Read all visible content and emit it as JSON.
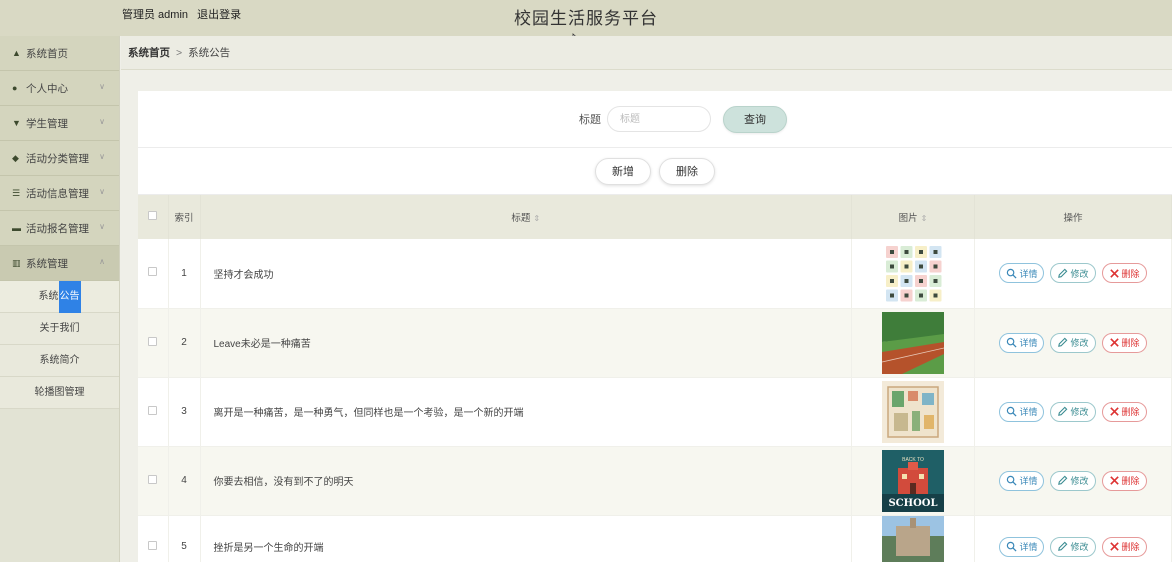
{
  "header": {
    "user_label": "管理员 admin",
    "logout_label": "退出登录",
    "title": "校园生活服务平台"
  },
  "breadcrumb": {
    "home": "系统首页",
    "separator": ">",
    "current": "系统公告"
  },
  "sidebar": {
    "items": [
      {
        "label": "系统首页",
        "icon": "home-icon"
      },
      {
        "label": "个人中心",
        "icon": "user-icon"
      },
      {
        "label": "学生管理",
        "icon": "student-icon"
      },
      {
        "label": "活动分类管理",
        "icon": "category-icon"
      },
      {
        "label": "活动信息管理",
        "icon": "info-icon"
      },
      {
        "label": "活动报名管理",
        "icon": "signup-icon"
      },
      {
        "label": "系统管理",
        "icon": "chart-icon"
      }
    ],
    "submenu": [
      {
        "label_a": "系统",
        "label_b": "公告"
      },
      {
        "label": "关于我们"
      },
      {
        "label": "系统简介"
      },
      {
        "label": "轮播图管理"
      }
    ]
  },
  "search": {
    "label": "标题",
    "placeholder": "标题",
    "query_label": "查询"
  },
  "actions": {
    "add_label": "新增",
    "delete_label": "删除"
  },
  "table": {
    "headers": {
      "index": "索引",
      "title": "标题",
      "image": "图片",
      "ops": "操作"
    },
    "sort_glyph": "⇕",
    "op_labels": {
      "detail": "详情",
      "edit": "修改",
      "delete": "删除"
    },
    "rows": [
      {
        "index": "1",
        "title": "坚持才会成功",
        "image": "icon-grid-picture"
      },
      {
        "index": "2",
        "title": "Leave未必是一种痛苦",
        "image": "running-track-picture"
      },
      {
        "index": "3",
        "title": "离开是一种痛苦，是一种勇气，但同样也是一个考验，是一个新的开端",
        "image": "campus-map-picture"
      },
      {
        "index": "4",
        "title": "你要去相信，没有到不了的明天",
        "image": "school-building-picture",
        "image_text": "SCHOOL",
        "image_subtext": "BACK TO"
      },
      {
        "index": "5",
        "title": "挫折是另一个生命的开端",
        "image": "campus-photo-picture"
      }
    ]
  },
  "colors": {
    "topbar": "#d9d9c4",
    "sidebar_item": "#d4d5be",
    "selection": "#2f82e6",
    "detail": "#3a88b8",
    "edit": "#3b8c92",
    "delete": "#dd3333"
  }
}
